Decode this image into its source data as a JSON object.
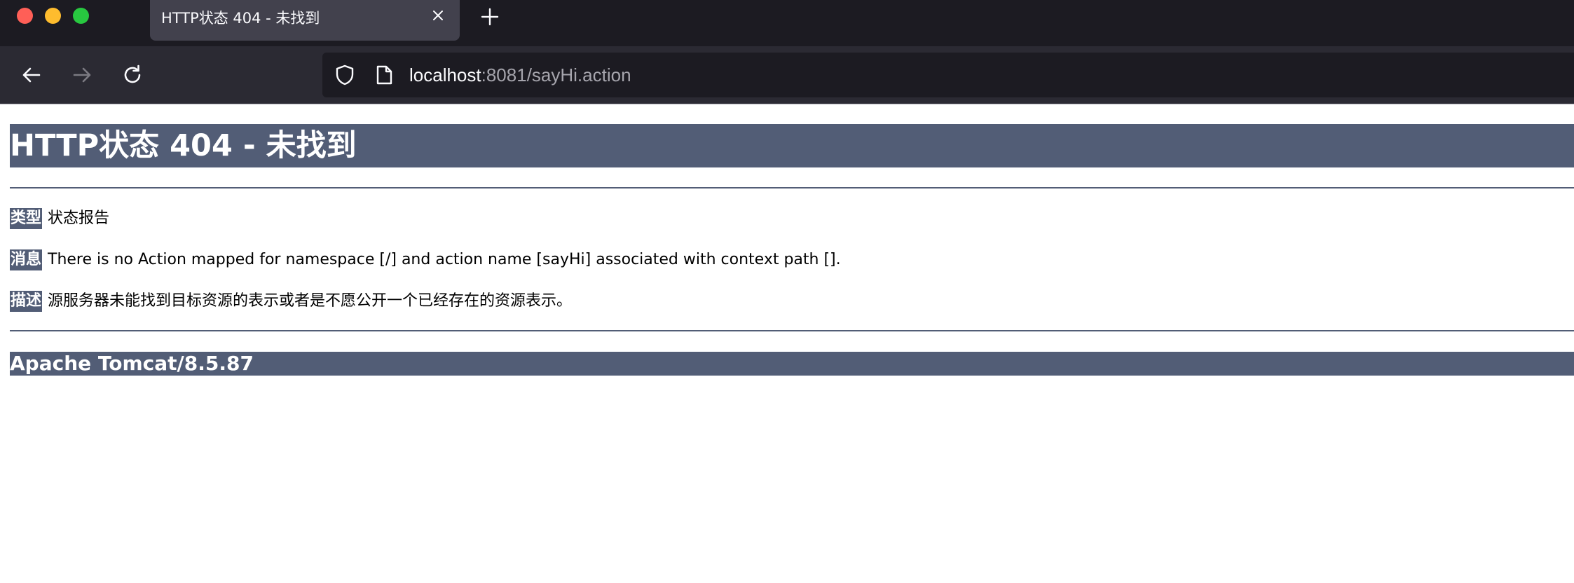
{
  "browser": {
    "tab": {
      "title": "HTTP状态 404 - 未找到"
    },
    "address": {
      "host": "localhost",
      "rest": ":8081/sayHi.action"
    },
    "icons": {
      "close": "close-icon",
      "new_tab": "plus-icon",
      "back": "arrow-left-icon",
      "forward": "arrow-right-icon",
      "reload": "reload-icon",
      "shield": "shield-icon",
      "page": "page-icon"
    }
  },
  "page": {
    "title": "HTTP状态 404 - 未找到",
    "rows": [
      {
        "label": "类型",
        "text": "状态报告"
      },
      {
        "label": "消息",
        "text": "There is no Action mapped for namespace [/] and action name [sayHi] associated with context path []."
      },
      {
        "label": "描述",
        "text": "源服务器未能找到目标资源的表示或者是不愿公开一个已经存在的资源表示。"
      }
    ],
    "footer": "Apache Tomcat/8.5.87"
  },
  "colors": {
    "tomcat_header": "#525d76",
    "chrome_dark": "#1c1b22",
    "chrome_toolbar": "#2b2a33"
  }
}
